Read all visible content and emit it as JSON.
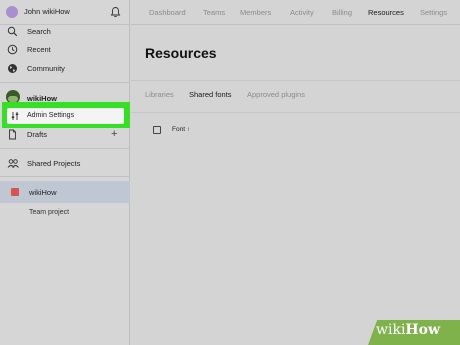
{
  "sidebar": {
    "user_name": "John wikiHow",
    "nav": {
      "search": "Search",
      "recent": "Recent",
      "community": "Community"
    },
    "team": {
      "name": "wikiHow",
      "admin_settings": "Admin Settings",
      "drafts": "Drafts"
    },
    "shared_projects": "Shared Projects",
    "project": {
      "name": "wikiHow",
      "sub": "Team project",
      "color": "#d9534f"
    }
  },
  "topnav": {
    "tabs": [
      "Dashboard",
      "Teams",
      "Members",
      "Activity",
      "Billing",
      "Resources",
      "Settings"
    ],
    "active": "Resources"
  },
  "main": {
    "title": "Resources",
    "subtabs": [
      "Libraries",
      "Shared fonts",
      "Approved plugins"
    ],
    "active_subtab": "Shared fonts",
    "table": {
      "column_font": "Font ↑"
    }
  },
  "highlight_color": "#35e024",
  "watermark": {
    "wiki": "wiki",
    "how": "How"
  }
}
